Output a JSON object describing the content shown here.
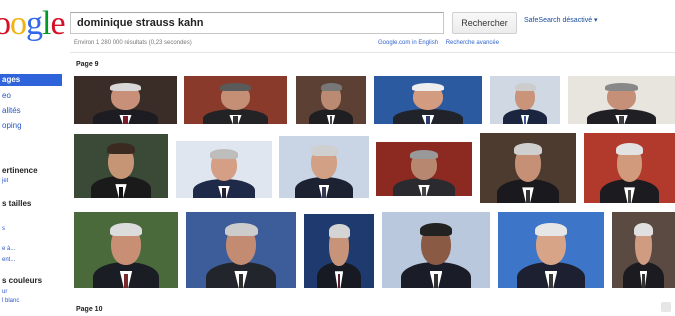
{
  "header": {
    "logo_text": "oogle",
    "search_value": "dominique strauss kahn",
    "search_button": "Rechercher",
    "safesearch": "SafeSearch désactivé ▾",
    "stats": "Environ 1 280 000 résultats (0,23 secondes)",
    "links": [
      "Google.com in English",
      "Recherche avancée"
    ]
  },
  "sidebar": {
    "active": "ages",
    "items": [
      "eo",
      "alités",
      "oping"
    ],
    "sections": [
      {
        "title": "ertinence",
        "sub": "jet"
      },
      {
        "title": "s tailles",
        "sub": ""
      },
      {
        "title": "",
        "sub": "s"
      },
      {
        "title": "",
        "sub": "e à..."
      },
      {
        "title": "",
        "sub": "ent..."
      },
      {
        "title": "s couleurs",
        "sub": "ur"
      },
      {
        "title": "",
        "sub": "l blanc"
      }
    ]
  },
  "results": {
    "page_labels": [
      "Page 9",
      "Page 10"
    ],
    "thumbnails": [
      {
        "row": 0,
        "name": "photo-1",
        "bg": "#3a2d28",
        "suit": "#1c1c22",
        "tie": "#7a1a2a",
        "skin": "#c89078",
        "hair": "#d8d8d8"
      },
      {
        "row": 0,
        "name": "photo-2",
        "bg": "#8a3a2a",
        "suit": "#232326",
        "tie": "#333",
        "skin": "#c48f74",
        "hair": "#5a5a5a"
      },
      {
        "row": 0,
        "name": "photo-3",
        "bg": "#5c4033",
        "suit": "#1f1f22",
        "tie": "#444",
        "skin": "#bb8a72",
        "hair": "#777"
      },
      {
        "row": 0,
        "name": "photo-4",
        "bg": "#2c5aa0",
        "suit": "#20232a",
        "tie": "#2b3b6e",
        "skin": "#d39b80",
        "hair": "#eeeeee"
      },
      {
        "row": 0,
        "name": "photo-5",
        "bg": "#cfd8e3",
        "suit": "#1b2540",
        "tie": "#3b5a9a",
        "skin": "#c99479",
        "hair": "#cccccc"
      },
      {
        "row": 0,
        "name": "photo-6",
        "bg": "#e8e4de",
        "suit": "#1f1f24",
        "tie": "#3c3c3c",
        "skin": "#c59077",
        "hair": "#888"
      },
      {
        "row": 1,
        "name": "photo-7",
        "bg": "#3a4a36",
        "suit": "#1a1a1a",
        "tie": "#111",
        "skin": "#c59576",
        "hair": "#3b2a20"
      },
      {
        "row": 1,
        "name": "photo-8",
        "bg": "#dfe6ef",
        "suit": "#1f2a48",
        "tie": "#223",
        "skin": "#d49f84",
        "hair": "#bdbdbd"
      },
      {
        "row": 1,
        "name": "photo-9",
        "bg": "#c9d4e4",
        "suit": "#1d2232",
        "tie": "#333a55",
        "skin": "#d2a084",
        "hair": "#cfcfcf"
      },
      {
        "row": 1,
        "name": "photo-10",
        "bg": "#8c2a22",
        "suit": "#2b2b2f",
        "tie": "#444",
        "skin": "#b88770",
        "hair": "#999"
      },
      {
        "row": 1,
        "name": "photo-11",
        "bg": "#4d3b30",
        "suit": "#1a1a1e",
        "tie": "#333",
        "skin": "#c69076",
        "hair": "#cfcfcf"
      },
      {
        "row": 1,
        "name": "photo-12",
        "bg": "#b23a2c",
        "suit": "#1c1c20",
        "tie": "#444",
        "skin": "#d19a7c",
        "hair": "#e2e2e2"
      },
      {
        "row": 2,
        "name": "photo-13",
        "bg": "#4a6a3c",
        "suit": "#1a1d24",
        "tie": "#7a2a2a",
        "skin": "#c98f75",
        "hair": "#dcdcdc"
      },
      {
        "row": 2,
        "name": "photo-14",
        "bg": "#3d5d9a",
        "suit": "#22252c",
        "tie": "#2f2f2f",
        "skin": "#c38c72",
        "hair": "#cccccc"
      },
      {
        "row": 2,
        "name": "photo-15",
        "bg": "#1e3a6e",
        "suit": "#171a22",
        "tie": "#5a1e2e",
        "skin": "#c7947a",
        "hair": "#d4d4d4"
      },
      {
        "row": 2,
        "name": "photo-16",
        "bg": "#b9c8dc",
        "suit": "#1a1d28",
        "tie": "#333",
        "skin": "#8a5a44",
        "hair": "#222"
      },
      {
        "row": 2,
        "name": "photo-17",
        "bg": "#3d76c8",
        "suit": "#1c2030",
        "tie": "#3a3a3a",
        "skin": "#d8a488",
        "hair": "#e6e6e6"
      },
      {
        "row": 2,
        "name": "photo-18",
        "bg": "#5a4a42",
        "suit": "#1c1c20",
        "tie": "#333",
        "skin": "#cf9c82",
        "hair": "#e0e0e0"
      }
    ]
  }
}
